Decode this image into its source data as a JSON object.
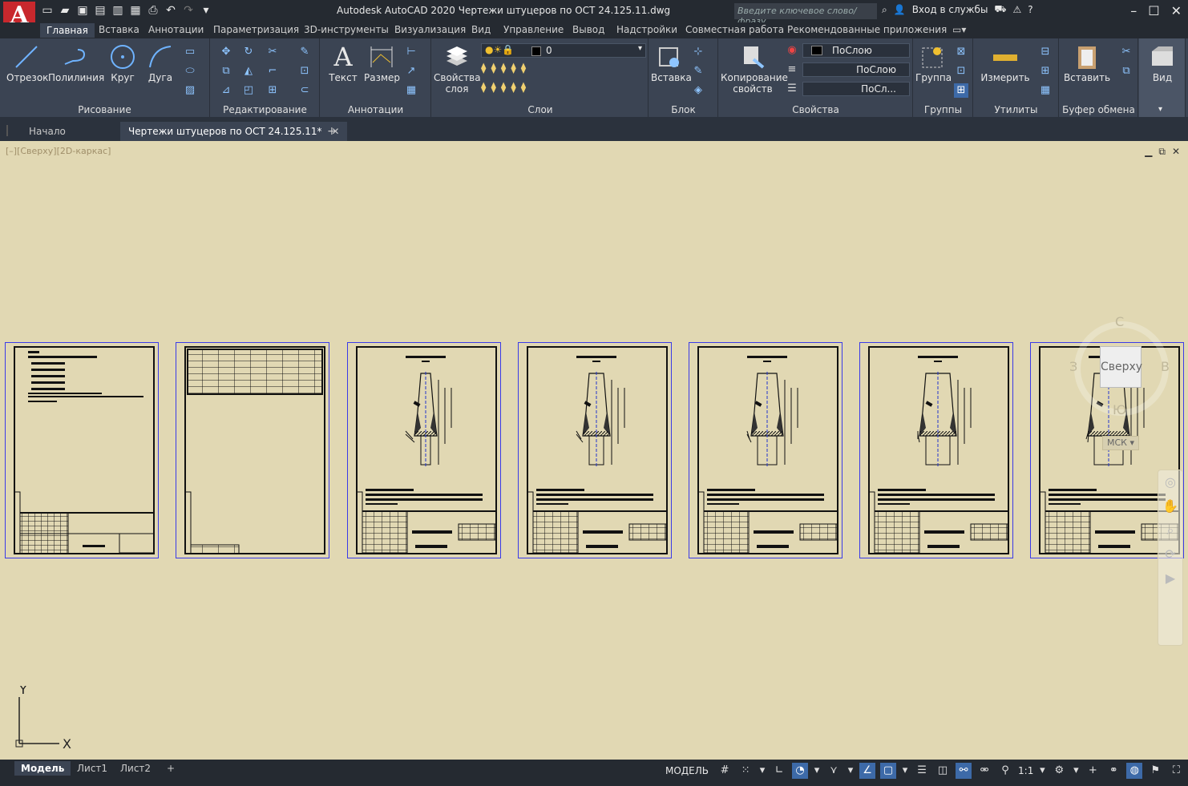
{
  "app": {
    "logo": "A",
    "title": "Autodesk AutoCAD 2020    Чертежи штуцеров по ОСТ 24.125.11.dwg",
    "search_placeholder": "Введите ключевое слово/фразу",
    "signin": "Вход в службы"
  },
  "ribbon_tabs": [
    "Главная",
    "Вставка",
    "Аннотации",
    "Параметризация",
    "3D-инструменты",
    "Визуализация",
    "Вид",
    "Управление",
    "Вывод",
    "Надстройки",
    "Совместная работа",
    "Рекомендованные приложения"
  ],
  "ribbon": {
    "draw": {
      "line": "Отрезок",
      "polyline": "Полилиния",
      "circle": "Круг",
      "arc": "Дуга",
      "title": "Рисование"
    },
    "modify": {
      "title": "Редактирование"
    },
    "annotation": {
      "text": "Текст",
      "dimension": "Размер",
      "title": "Аннотации"
    },
    "layers": {
      "layer_props": "Свойства слоя",
      "layer_value": "0",
      "title": "Слои"
    },
    "block": {
      "insert": "Вставка",
      "title": "Блок"
    },
    "properties": {
      "match": "Копирование свойств",
      "color": "ПоСлою",
      "linetype": "ПоСлою",
      "lineweight": "ПоСл...",
      "title": "Свойства"
    },
    "groups": {
      "group": "Группа",
      "title": "Группы"
    },
    "utilities": {
      "measure": "Измерить",
      "title": "Утилиты"
    },
    "clipboard": {
      "paste": "Вставить",
      "title": "Буфер обмена"
    },
    "view": {
      "view": "Вид"
    }
  },
  "file_tabs": [
    "Начало",
    "Чертежи штуцеров по ОСТ 24.125.11*"
  ],
  "viewport": {
    "label": "[–][Сверху][2D-каркас]",
    "viewcube_face": "Сверху",
    "dir_n": "С",
    "dir_s": "Ю",
    "dir_w": "З",
    "dir_e": "В",
    "wcs": "МСК",
    "ucs_x": "X",
    "ucs_y": "Y"
  },
  "layout_tabs": [
    "Модель",
    "Лист1",
    "Лист2"
  ],
  "status": {
    "model": "МОДЕЛЬ",
    "scale": "1:1"
  }
}
